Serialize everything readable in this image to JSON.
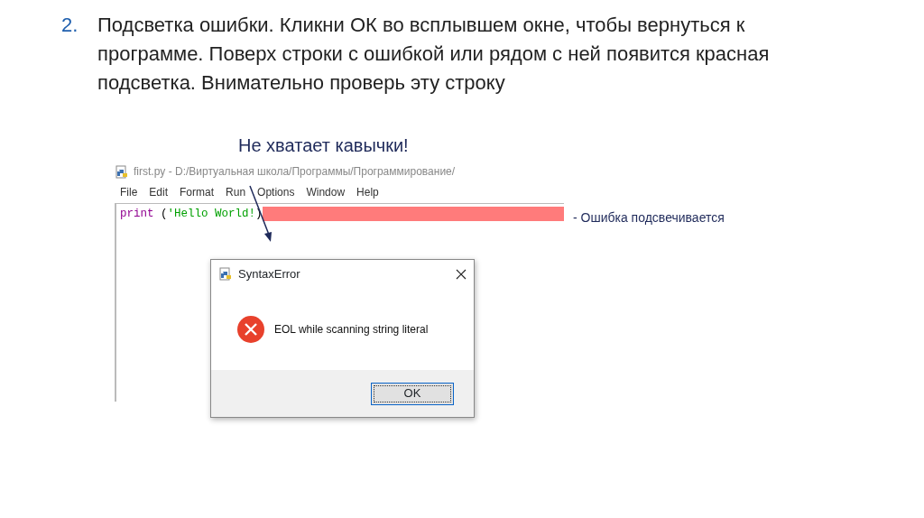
{
  "slide": {
    "number": "2.",
    "text": "Подсветка ошибки. Кликни ОК во всплывшем окне, чтобы вернуться к программе. Поверх строки с ошибкой или рядом с ней появится красная подсветка. Внимательно проверь эту строку"
  },
  "annotation": {
    "text": "Не хватает кавычки!"
  },
  "editor": {
    "title": "first.py - D:/Виртуальная школа/Программы/Программирование/",
    "menu": [
      "File",
      "Edit",
      "Format",
      "Run",
      "Options",
      "Window",
      "Help"
    ],
    "code": [
      {
        "text": "print",
        "kind": "builtin"
      },
      {
        "text": " (",
        "kind": "plain"
      },
      {
        "text": "'Hello World!",
        "kind": "string"
      },
      {
        "text": ")",
        "kind": "plain"
      }
    ],
    "error_highlight": true
  },
  "legend": {
    "text": "- Ошибка подсвечивается"
  },
  "dialog": {
    "title": "SyntaxError",
    "message": "EOL while scanning string literal",
    "buttons": [
      "OK"
    ]
  }
}
